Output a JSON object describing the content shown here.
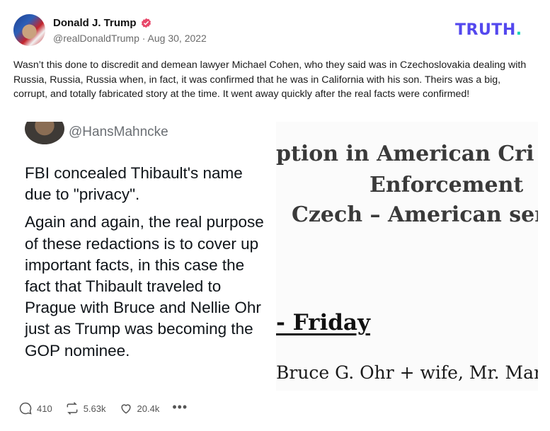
{
  "post": {
    "display_name": "Donald J. Trump",
    "handle": "@realDonaldTrump",
    "separator": "·",
    "date": "Aug 30, 2022",
    "text": "Wasn’t this done to discredit and demean lawyer Michael Cohen, who they said was in Czechoslovakia dealing with Russia, Russia, Russia when, in fact, it was confirmed that he was in California with his son. Theirs was a big, corrupt, and totally fabricated story at the time. It went away quickly after the real facts were confirmed!"
  },
  "brand": {
    "name": "TRUTH",
    "dot": "."
  },
  "media": {
    "tweet_handle": "@HansMahncke",
    "tweet_p1": "FBI concealed Thibault's name due to \"privacy\".",
    "tweet_p2": "Again and again, the real purpose of these redactions is to cover up important facts, in this case the fact that Thibault traveled to Prague with Bruce and Nellie Ohr just as Trump was becoming the GOP nominee.",
    "doc_line1": "ption in American Cri",
    "doc_line2": "Enforcement",
    "doc_line3": "Czech – American ser",
    "doc_line4": "- Friday",
    "doc_line5": "Bruce G. Ohr + wife, Mr. Mark D"
  },
  "actions": {
    "replies": "410",
    "retruths": "5.63k",
    "likes": "20.4k",
    "more": "•••"
  },
  "colors": {
    "brand_purple": "#5448ee",
    "brand_teal": "#17d3b6",
    "verified": "#e8486a"
  }
}
